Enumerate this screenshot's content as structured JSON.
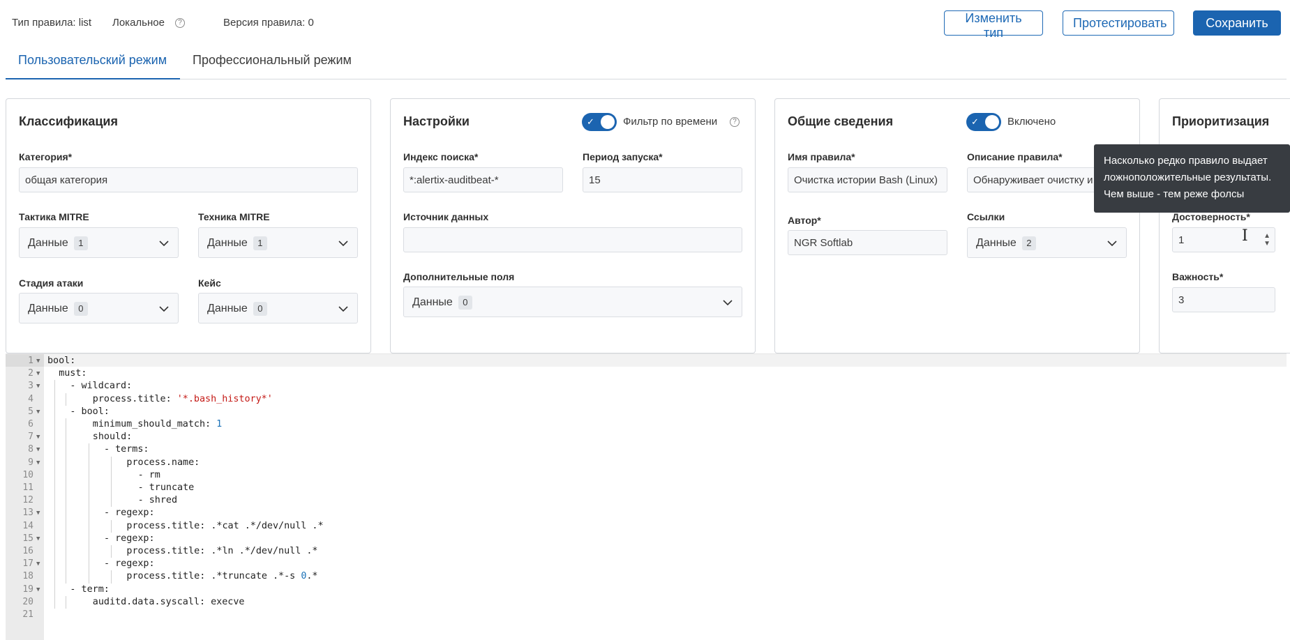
{
  "header": {
    "rule_type": "Тип правила: list",
    "local": "Локальное",
    "version": "Версия правила: 0",
    "change_type_label": "Изменить тип",
    "test_label": "Протестировать",
    "save_label": "Сохранить"
  },
  "tabs": [
    {
      "label": "Пользовательский режим",
      "active": true
    },
    {
      "label": "Профессиональный режим",
      "active": false
    }
  ],
  "classification": {
    "title": "Классификация",
    "category_label": "Категория*",
    "category_value": "общая категория",
    "tactic_label": "Тактика MITRE",
    "tactic_value": "Данные",
    "tactic_count": "1",
    "technique_label": "Техника MITRE",
    "technique_value": "Данные",
    "technique_count": "1",
    "stage_label": "Стадия атаки",
    "stage_value": "Данные",
    "stage_count": "0",
    "case_label": "Кейс",
    "case_value": "Данные",
    "case_count": "0"
  },
  "settings": {
    "title": "Настройки",
    "time_filter_label": "Фильтр по времени",
    "index_label": "Индекс поиска*",
    "index_value": "*:alertix-auditbeat-*",
    "period_label": "Период запуска*",
    "period_value": "15",
    "source_label": "Источник данных",
    "source_value": "",
    "extra_label": "Дополнительные поля",
    "extra_value": "Данные",
    "extra_count": "0"
  },
  "general": {
    "title": "Общие сведения",
    "enabled_label": "Включено",
    "name_label": "Имя правила*",
    "name_value": "Очистка истории Bash (Linux)",
    "desc_label": "Описание правила*",
    "desc_value": "Обнаруживает очистку и",
    "author_label": "Автор*",
    "author_value": "NGR Softlab",
    "links_label": "Ссылки",
    "links_value": "Данные",
    "links_count": "2"
  },
  "priority": {
    "title": "Приоритизация",
    "confidence_label": "Достоверность*",
    "confidence_value": "1",
    "importance_label": "Важность*",
    "importance_value": "3"
  },
  "tooltip": {
    "line1": "Насколько редко правило выдает",
    "line2": "ложноположительные результаты.",
    "line3": "Чем выше - тем реже фолсы"
  },
  "editor": {
    "lines": [
      {
        "n": "1",
        "fold": true,
        "indent": 0,
        "parts": [
          {
            "t": "bool:"
          }
        ]
      },
      {
        "n": "2",
        "fold": true,
        "indent": 1,
        "parts": [
          {
            "t": "must:"
          }
        ]
      },
      {
        "n": "3",
        "fold": true,
        "indent": 2,
        "parts": [
          {
            "t": "- wildcard:"
          }
        ]
      },
      {
        "n": "4",
        "fold": false,
        "indent": 4,
        "parts": [
          {
            "t": "process.title: "
          },
          {
            "t": "'*.bash_history*'",
            "c": "str"
          }
        ]
      },
      {
        "n": "5",
        "fold": true,
        "indent": 2,
        "parts": [
          {
            "t": "- bool:"
          }
        ]
      },
      {
        "n": "6",
        "fold": false,
        "indent": 4,
        "parts": [
          {
            "t": "minimum_should_match: "
          },
          {
            "t": "1",
            "c": "num"
          }
        ]
      },
      {
        "n": "7",
        "fold": true,
        "indent": 4,
        "parts": [
          {
            "t": "should:"
          }
        ]
      },
      {
        "n": "8",
        "fold": true,
        "indent": 5,
        "parts": [
          {
            "t": "- terms:"
          }
        ]
      },
      {
        "n": "9",
        "fold": true,
        "indent": 7,
        "parts": [
          {
            "t": "process.name:"
          }
        ]
      },
      {
        "n": "10",
        "fold": false,
        "indent": 8,
        "parts": [
          {
            "t": "- rm"
          }
        ]
      },
      {
        "n": "11",
        "fold": false,
        "indent": 8,
        "parts": [
          {
            "t": "- truncate"
          }
        ]
      },
      {
        "n": "12",
        "fold": false,
        "indent": 8,
        "parts": [
          {
            "t": "- shred"
          }
        ]
      },
      {
        "n": "13",
        "fold": true,
        "indent": 5,
        "parts": [
          {
            "t": "- regexp:"
          }
        ]
      },
      {
        "n": "14",
        "fold": false,
        "indent": 7,
        "parts": [
          {
            "t": "process.title: .*cat .*/dev/null .*"
          }
        ]
      },
      {
        "n": "15",
        "fold": true,
        "indent": 5,
        "parts": [
          {
            "t": "- regexp:"
          }
        ]
      },
      {
        "n": "16",
        "fold": false,
        "indent": 7,
        "parts": [
          {
            "t": "process.title: .*ln .*/dev/null .*"
          }
        ]
      },
      {
        "n": "17",
        "fold": true,
        "indent": 5,
        "parts": [
          {
            "t": "- regexp:"
          }
        ]
      },
      {
        "n": "18",
        "fold": false,
        "indent": 7,
        "parts": [
          {
            "t": "process.title: .*truncate .*-s "
          },
          {
            "t": "0",
            "c": "num"
          },
          {
            "t": ".*"
          }
        ]
      },
      {
        "n": "19",
        "fold": true,
        "indent": 2,
        "parts": [
          {
            "t": "- term:"
          }
        ]
      },
      {
        "n": "20",
        "fold": false,
        "indent": 4,
        "parts": [
          {
            "t": "auditd.data.syscall: execve"
          }
        ]
      },
      {
        "n": "21",
        "fold": false,
        "indent": 0,
        "parts": [
          {
            "t": ""
          }
        ]
      }
    ]
  },
  "colors": {
    "accent": "#1b64b0",
    "tooltip_bg": "#383c41",
    "string": "#c41a16",
    "number": "#1c72b8"
  }
}
